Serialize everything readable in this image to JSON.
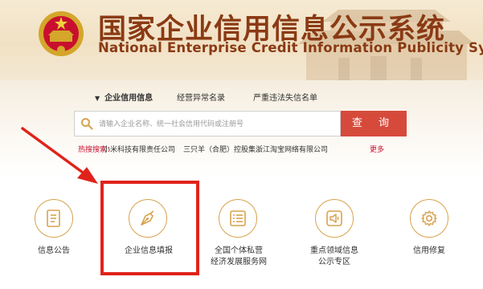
{
  "header": {
    "title_cn": "国家企业信用信息公示系统",
    "title_en": "National Enterprise Credit Information Publicity System"
  },
  "tabs": [
    {
      "label": "企业信用信息",
      "active": true
    },
    {
      "label": "经营异常名录",
      "active": false
    },
    {
      "label": "严重违法失信名单",
      "active": false
    }
  ],
  "search": {
    "placeholder": "请输入企业名称、统一社会信用代码或注册号",
    "button_label": "查  询"
  },
  "hot": {
    "label": "热搜搜索：",
    "items": [
      "小米科技有限责任公司",
      "三只羊（合肥）控股集...",
      "浙江淘宝网络有限公司"
    ],
    "more": "更多"
  },
  "services": [
    {
      "icon": "document-icon",
      "label": "信息公告"
    },
    {
      "icon": "pen-nib-icon",
      "label": "企业信息填报"
    },
    {
      "icon": "list-icon",
      "label": "全国个体私营\n经济发展服务网"
    },
    {
      "icon": "megaphone-icon",
      "label": "重点领域信息\n公示专区"
    },
    {
      "icon": "gear-icon",
      "label": "信用修复"
    }
  ],
  "colors": {
    "brand": "#8a3a14",
    "search_button": "#d64a3c",
    "highlight": "#e0231a",
    "icon_ring": "#d7a34e"
  }
}
